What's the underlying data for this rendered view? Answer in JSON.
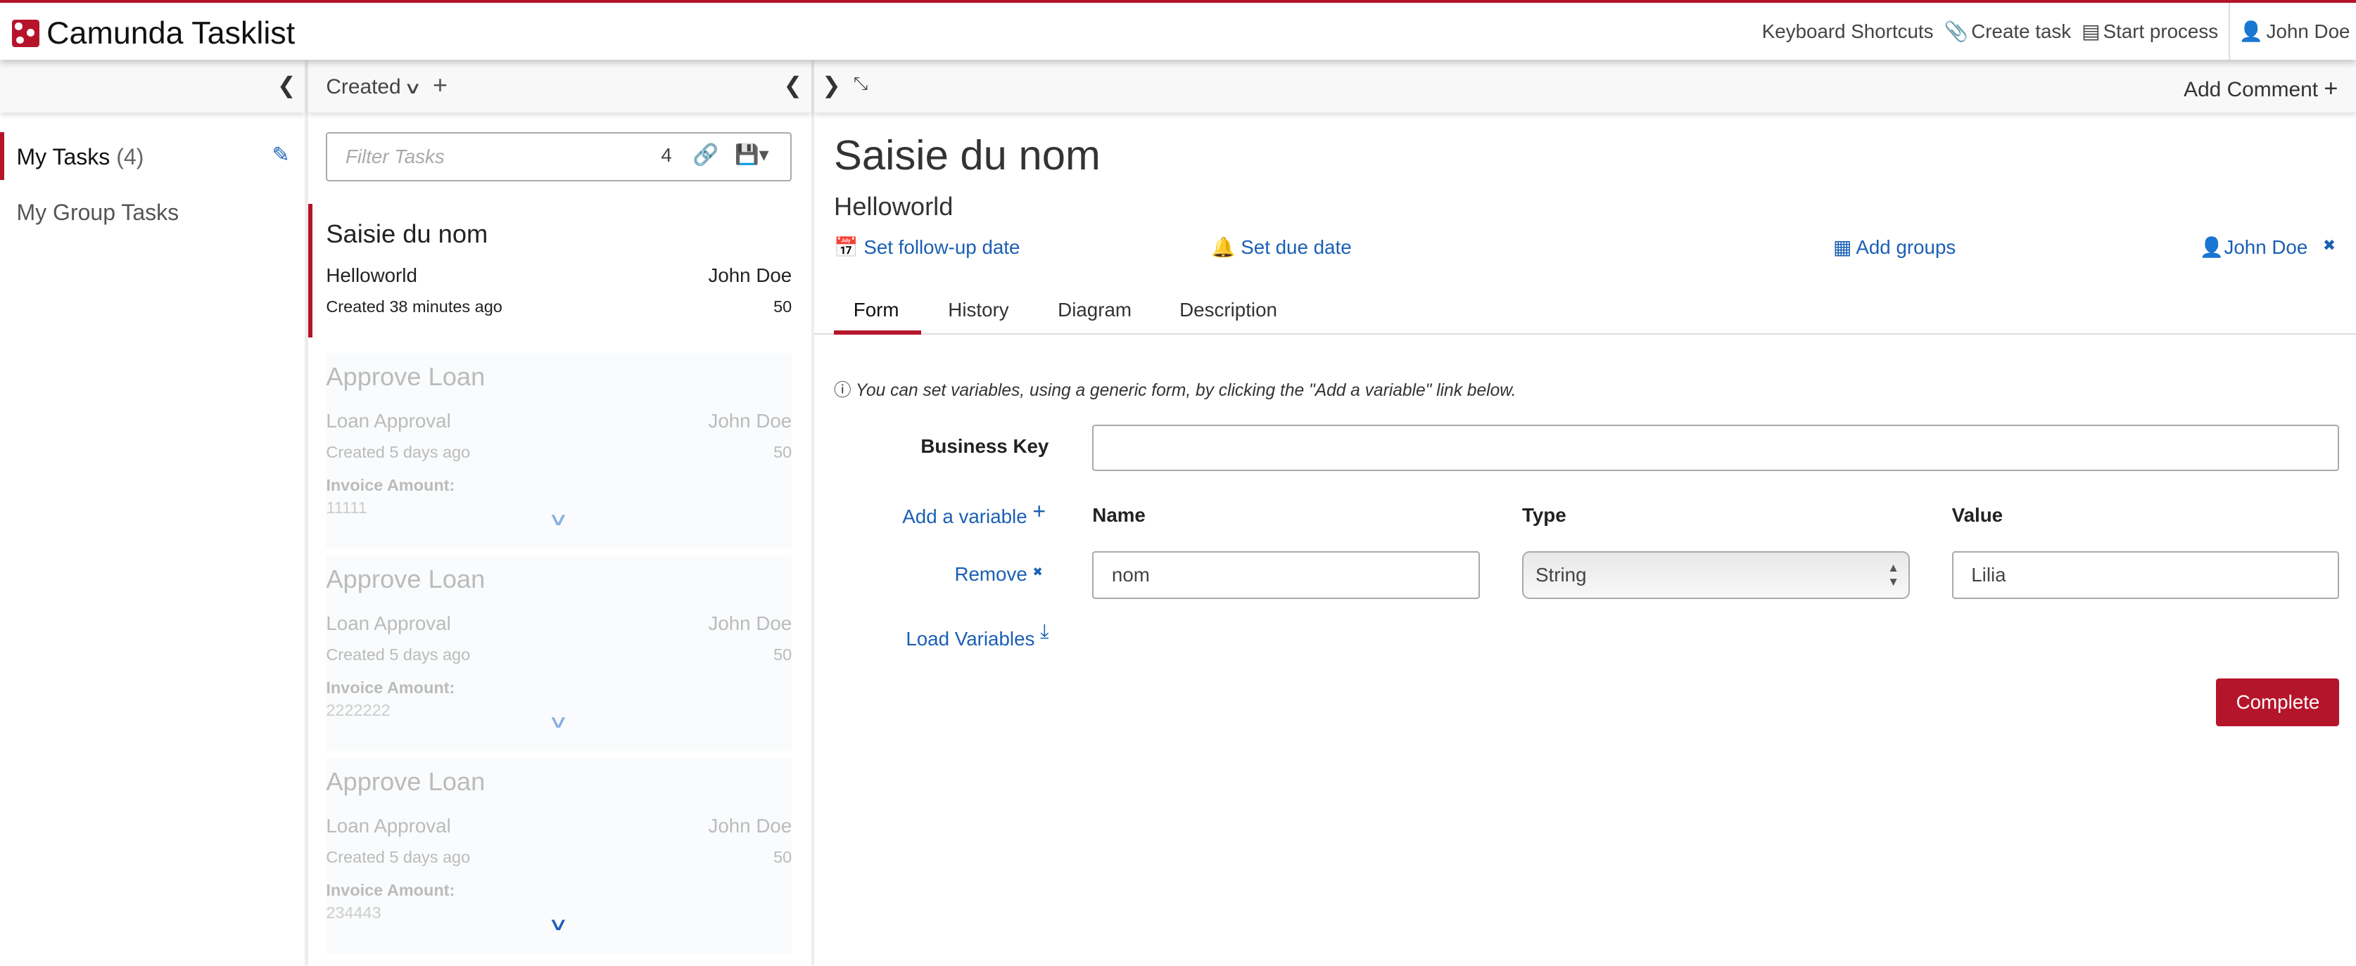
{
  "header": {
    "title": "Camunda Tasklist",
    "nav": {
      "shortcuts": "Keyboard Shortcuts",
      "create_task": "Create task",
      "start_process": "Start process",
      "user": "John Doe"
    }
  },
  "sidebar": {
    "items": [
      {
        "label": "My Tasks",
        "count": "(4)"
      },
      {
        "label": "My Group Tasks"
      }
    ]
  },
  "list": {
    "sort_label": "Created",
    "filter_placeholder": "Filter Tasks",
    "count": "4",
    "selected": {
      "title": "Saisie du nom",
      "process": "Helloworld",
      "assignee": "John Doe",
      "created": "Created 38 minutes ago",
      "priority": "50"
    },
    "items": [
      {
        "title": "Approve Loan",
        "process": "Loan Approval",
        "assignee": "John Doe",
        "created": "Created 5 days ago",
        "priority": "50",
        "var_label": "Invoice Amount:",
        "var_value": "11111"
      },
      {
        "title": "Approve Loan",
        "process": "Loan Approval",
        "assignee": "John Doe",
        "created": "Created 5 days ago",
        "priority": "50",
        "var_label": "Invoice Amount:",
        "var_value": "2222222"
      },
      {
        "title": "Approve Loan",
        "process": "Loan Approval",
        "assignee": "John Doe",
        "created": "Created 5 days ago",
        "priority": "50",
        "var_label": "Invoice Amount:",
        "var_value": "234443"
      }
    ]
  },
  "detail": {
    "add_comment": "Add Comment",
    "title": "Saisie du nom",
    "process": "Helloworld",
    "follow_up": "Set follow-up date",
    "due": "Set due date",
    "groups": "Add groups",
    "assignee": "John Doe",
    "tabs": [
      "Form",
      "History",
      "Diagram",
      "Description"
    ],
    "info": "You can set variables, using a generic form, by clicking the \"Add a variable\" link below.",
    "business_key_label": "Business Key",
    "business_key_value": "",
    "add_variable": "Add a variable",
    "col_name": "Name",
    "col_type": "Type",
    "col_value": "Value",
    "remove": "Remove",
    "var_name": "nom",
    "var_type": "String",
    "var_value": "Lilia",
    "load_variables": "Load Variables",
    "complete": "Complete"
  },
  "colors": {
    "brand": "#b5152b",
    "link": "#1a5fb4"
  }
}
